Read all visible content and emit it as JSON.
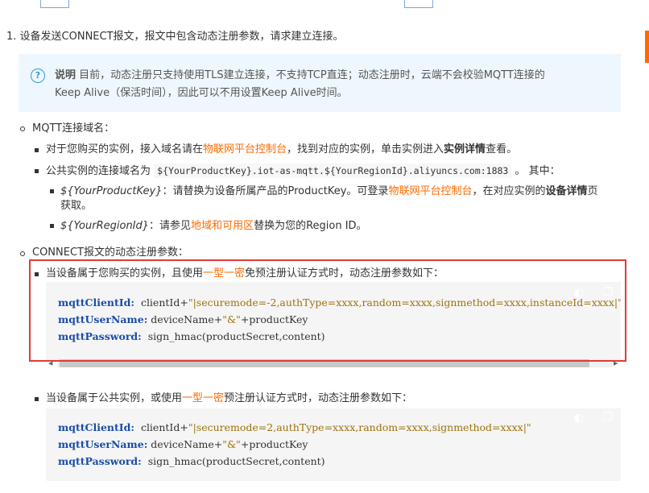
{
  "step": {
    "number": "1.",
    "text": "设备发送CONNECT报文，报文中包含动态注册参数，请求建立连接。"
  },
  "note": {
    "label": "说明",
    "line1": "目前，动态注册只支持使用TLS建立连接，不支持TCP直连；动态注册时，云端不会校验MQTT连接的",
    "line2": "Keep Alive（保活时间），因此可以不用设置Keep Alive时间。"
  },
  "domain_section": {
    "title": "MQTT连接域名：",
    "item1": {
      "pre": "对于您购买的实例，接入域名请在",
      "link": "物联网平台控制台",
      "mid": "，找到对应的实例，单击实例进入",
      "bold": "实例详情",
      "post": "查看。"
    },
    "item2": {
      "pre": "公共实例的连接域名为",
      "code": "${YourProductKey}.iot-as-mqtt.${YourRegionId}.aliyuncs.com:1883",
      "post": "。 其中："
    },
    "sub1": {
      "var": "${YourProductKey}",
      "pre": "：请替换为设备所属产品的ProductKey。可登录",
      "link": "物联网平台控制台",
      "mid": "，在对应实例的",
      "bold": "设备详情",
      "post": "页",
      "line2": "获取。"
    },
    "sub2": {
      "var": "${YourRegionId}",
      "pre": "：请参见",
      "link": "地域和可用区",
      "post": "替换为您的Region ID。"
    }
  },
  "connect_section": {
    "title": "CONNECT报文的动态注册参数：",
    "purchased": {
      "pre": "当设备属于您购买的实例，且使用",
      "link": "一型一密",
      "post": "免预注册认证方式时，动态注册参数如下：",
      "code": {
        "l1_key": "mqttClientId:",
        "l1_val": "clientId+",
        "l1_str": "\"|securemode=-2,authType=xxxx,random=xxxx,signmethod=xxxx,instanceId=xxxx|\"",
        "l2_key": "mqttUserName:",
        "l2_val": "deviceName+",
        "l2_str": "\"&\"",
        "l2_rest": "+productKey",
        "l3_key": "mqttPassword:",
        "l3_val": "sign_hmac(productSecret,content)"
      }
    },
    "public": {
      "pre": "当设备属于公共实例，或使用",
      "link": "一型一密",
      "post": "预注册认证方式时，动态注册参数如下：",
      "code": {
        "l1_key": "mqttClientId:",
        "l1_val": "clientId+",
        "l1_str": "\"|securemode=2,authType=xxxx,random=xxxx,signmethod=xxxx|\"",
        "l2_key": "mqttUserName:",
        "l2_val": "deviceName+",
        "l2_str": "\"&\"",
        "l2_rest": "+productKey",
        "l3_key": "mqttPassword:",
        "l3_val": "sign_hmac(productSecret,content)"
      }
    }
  },
  "icons": {
    "note_icon": "?",
    "wrap_icon": "◐",
    "copy_icon": "❐",
    "scroll_left": "◀",
    "scroll_right": "▶"
  },
  "colors": {
    "link": "#ff6a00",
    "note_bg": "#eef7fd",
    "highlight_frame": "#e23a3a",
    "code_key": "#1a4ca8",
    "code_string": "#a0720b"
  }
}
